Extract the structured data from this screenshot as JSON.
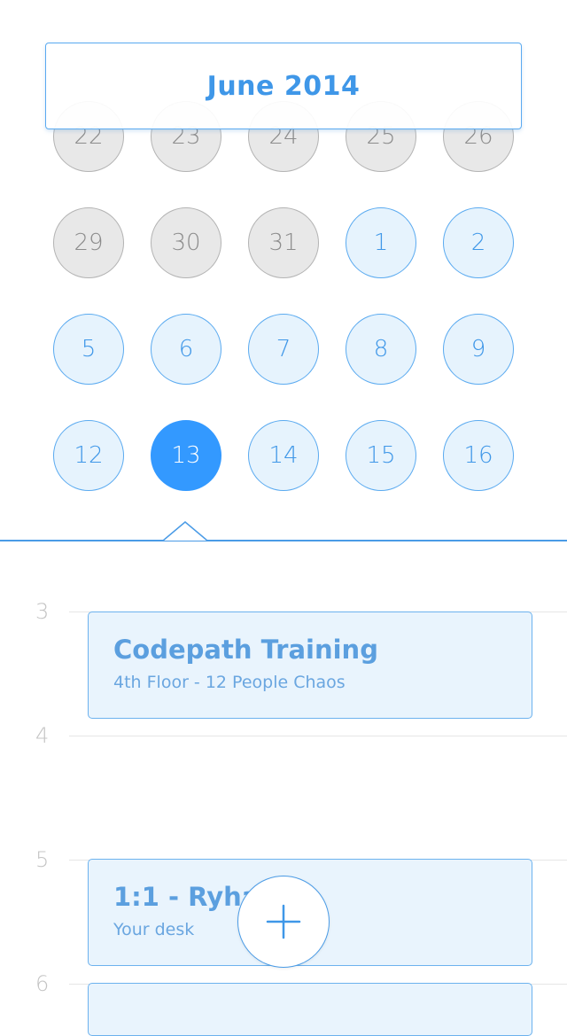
{
  "calendar": {
    "month_label": "June 2014",
    "weeks": [
      [
        {
          "label": "22",
          "state": "past"
        },
        {
          "label": "23",
          "state": "past"
        },
        {
          "label": "24",
          "state": "past"
        },
        {
          "label": "25",
          "state": "past"
        },
        {
          "label": "26",
          "state": "past"
        }
      ],
      [
        {
          "label": "29",
          "state": "past"
        },
        {
          "label": "30",
          "state": "past"
        },
        {
          "label": "31",
          "state": "past"
        },
        {
          "label": "1",
          "state": "current"
        },
        {
          "label": "2",
          "state": "current"
        }
      ],
      [
        {
          "label": "5",
          "state": "current"
        },
        {
          "label": "6",
          "state": "current"
        },
        {
          "label": "7",
          "state": "current"
        },
        {
          "label": "8",
          "state": "current"
        },
        {
          "label": "9",
          "state": "current"
        }
      ],
      [
        {
          "label": "12",
          "state": "current"
        },
        {
          "label": "13",
          "state": "selected"
        },
        {
          "label": "14",
          "state": "current"
        },
        {
          "label": "15",
          "state": "current"
        },
        {
          "label": "16",
          "state": "current"
        }
      ]
    ]
  },
  "schedule": {
    "hours": [
      "3",
      "4",
      "5",
      "6"
    ],
    "events": [
      {
        "title": "Codepath Training",
        "subtitle": "4th Floor - 12 People Chaos"
      },
      {
        "title": "1:1 - Ryhan",
        "subtitle": "Your desk"
      },
      {
        "title": "",
        "subtitle": ""
      }
    ]
  },
  "fab": {
    "icon": "plus-icon"
  },
  "colors": {
    "accent": "#3399ff",
    "accent_text": "#3f97e8",
    "past_fill": "#e8e8e8",
    "current_fill": "#e6f3fd",
    "event_fill": "#e9f4fd"
  }
}
